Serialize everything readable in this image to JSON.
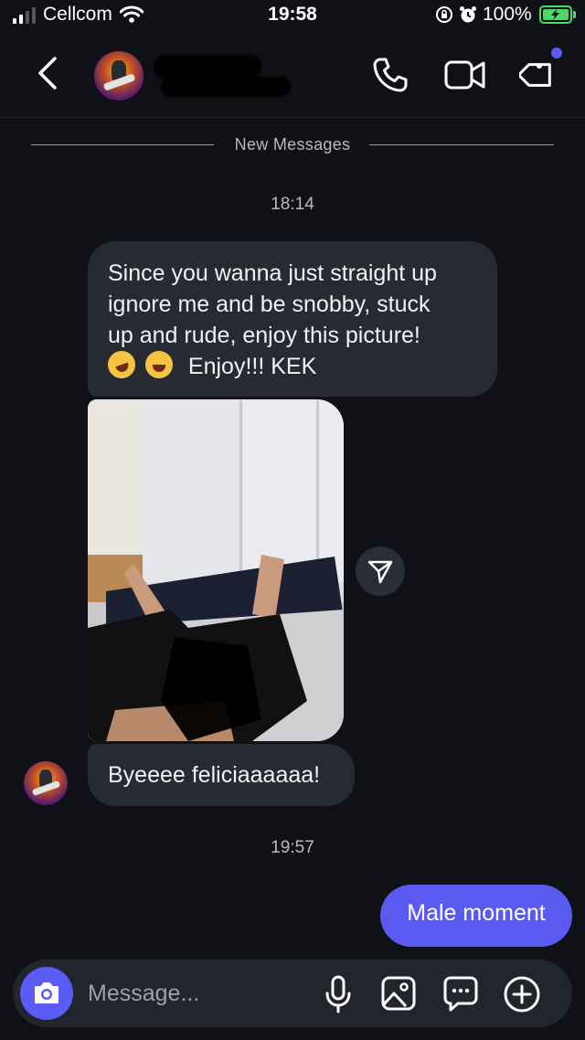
{
  "status_bar": {
    "carrier": "Cellcom",
    "time": "19:58",
    "battery": "100%",
    "battery_level": 1.0
  },
  "header": {
    "contact_name": ""
  },
  "conversation": {
    "divider_label": "New Messages",
    "timestamp_1": "18:14",
    "incoming_1_lines": [
      "Since you wanna just straight up",
      "ignore me and be snobby, stuck",
      "up and rude, enjoy this picture!"
    ],
    "incoming_1_emoji_line": "Enjoy!!! KEK",
    "incoming_2": "Byeeee feliciaaaaaa!",
    "timestamp_2": "19:57",
    "outgoing_1": "Male moment"
  },
  "composer": {
    "placeholder": "Message..."
  },
  "colors": {
    "background": "#0f1116",
    "incoming_bubble": "#262a33",
    "outgoing_bubble": "#5a5af1",
    "accent": "#5b5cf5",
    "battery": "#4cd964"
  },
  "icons": [
    "signal-icon",
    "wifi-icon",
    "lock-rotation-icon",
    "alarm-icon",
    "battery-icon",
    "back-icon",
    "phone-icon",
    "video-icon",
    "tag-icon",
    "share-icon",
    "camera-icon",
    "microphone-icon",
    "gallery-icon",
    "sticker-icon",
    "plus-icon"
  ]
}
